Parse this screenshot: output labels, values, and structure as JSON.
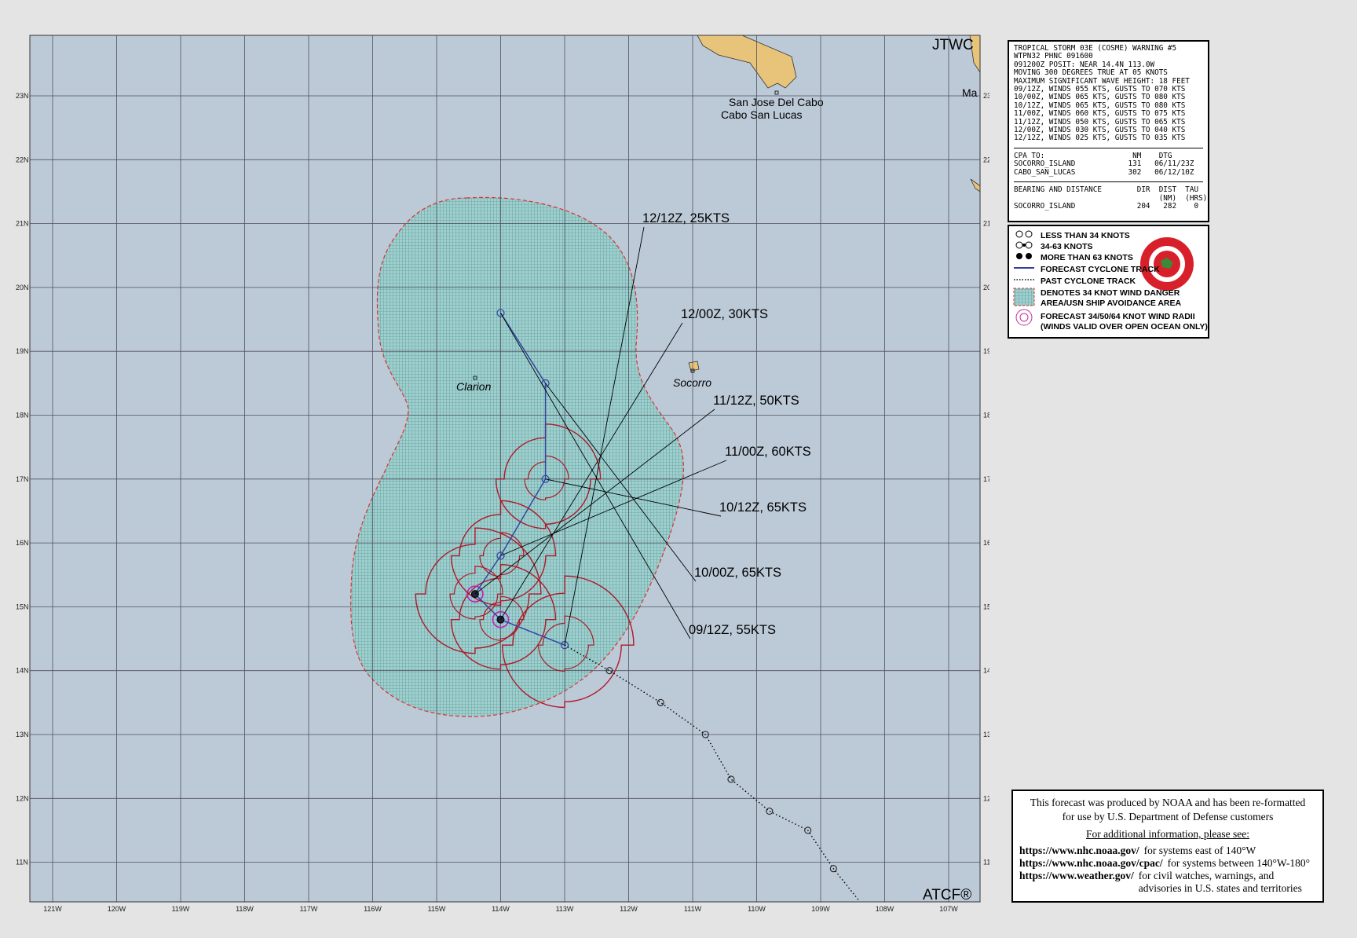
{
  "map": {
    "agency_label": "JTWC",
    "atcf_label": "ATCF®",
    "lon_labels": [
      "121W",
      "120W",
      "119W",
      "118W",
      "117W",
      "116W",
      "115W",
      "114W",
      "113W",
      "112W",
      "111W",
      "110W",
      "109W",
      "108W",
      "107W"
    ],
    "lat_labels": [
      "23N",
      "22N",
      "21N",
      "20N",
      "19N",
      "18N",
      "17N",
      "16N",
      "15N",
      "14N",
      "13N",
      "12N",
      "11N"
    ],
    "places": [
      {
        "name": "San Jose Del Cabo"
      },
      {
        "name": "Cabo San Lucas"
      },
      {
        "name": "Clarion"
      },
      {
        "name": "Socorro"
      },
      {
        "name": "Ma"
      }
    ],
    "forecast_labels": [
      "12/12Z,  25KTS",
      "12/00Z,  30KTS",
      "11/12Z,  50KTS",
      "11/00Z,  60KTS",
      "10/12Z,  65KTS",
      "10/00Z,  65KTS",
      "09/12Z,  55KTS"
    ],
    "forecast_track": [
      {
        "time": "09/12Z",
        "lat": 14.4,
        "lon": -113.0,
        "kts": 55
      },
      {
        "time": "10/00Z",
        "lat": 14.8,
        "lon": -114.0,
        "kts": 65
      },
      {
        "time": "10/12Z",
        "lat": 15.2,
        "lon": -114.4,
        "kts": 65
      },
      {
        "time": "11/00Z",
        "lat": 15.8,
        "lon": -114.0,
        "kts": 60
      },
      {
        "time": "11/12Z",
        "lat": 17.0,
        "lon": -113.3,
        "kts": 50
      },
      {
        "time": "12/00Z",
        "lat": 18.5,
        "lon": -113.3,
        "kts": 30
      },
      {
        "time": "12/12Z",
        "lat": 19.6,
        "lon": -114.0,
        "kts": 25
      }
    ],
    "past_track": [
      {
        "lat": 14.0,
        "lon": -112.3
      },
      {
        "lat": 13.5,
        "lon": -111.5
      },
      {
        "lat": 13.0,
        "lon": -110.8
      },
      {
        "lat": 12.3,
        "lon": -110.4
      },
      {
        "lat": 11.8,
        "lon": -109.8
      },
      {
        "lat": 11.5,
        "lon": -109.2
      },
      {
        "lat": 10.9,
        "lon": -108.8
      }
    ],
    "colors": {
      "ocean": "#bccad8",
      "land": "#e8c47a",
      "grid": "#4a4a5a",
      "danger_area": "#9fcfcf",
      "danger_border": "#e03030",
      "wind_radii": "#b01828",
      "track": "#3040a0",
      "small_radii": "#c020c0"
    }
  },
  "warning": {
    "header_lines": [
      "TROPICAL STORM 03E (COSME) WARNING #5",
      "WTPN32 PHNC 091600",
      "091200Z POSIT: NEAR 14.4N 113.0W",
      "MOVING 300 DEGREES TRUE AT 05 KNOTS",
      "MAXIMUM SIGNIFICANT WAVE HEIGHT: 18 FEET",
      "09/12Z, WINDS 055 KTS, GUSTS TO 070 KTS",
      "10/00Z, WINDS 065 KTS, GUSTS TO 080 KTS",
      "10/12Z, WINDS 065 KTS, GUSTS TO 080 KTS",
      "11/00Z, WINDS 060 KTS, GUSTS TO 075 KTS",
      "11/12Z, WINDS 050 KTS, GUSTS TO 065 KTS",
      "12/00Z, WINDS 030 KTS, GUSTS TO 040 KTS",
      "12/12Z, WINDS 025 KTS, GUSTS TO 035 KTS"
    ],
    "cpa_lines": [
      "CPA TO:                    NM    DTG",
      "SOCORRO_ISLAND            131   06/11/23Z",
      "CABO_SAN_LUCAS            302   06/12/10Z"
    ],
    "bearing_lines": [
      "BEARING AND DISTANCE        DIR  DIST  TAU",
      "                                 (NM)  (HRS)",
      "SOCORRO_ISLAND              204   282    0"
    ]
  },
  "legend": {
    "items": [
      "LESS THAN 34 KNOTS",
      "34-63 KNOTS",
      "MORE THAN 63 KNOTS",
      "FORECAST CYCLONE TRACK",
      "PAST CYCLONE TRACK",
      "DENOTES 34 KNOT WIND DANGER",
      "AREA/USN SHIP AVOIDANCE AREA",
      "FORECAST 34/50/64 KNOT WIND RADII",
      "(WINDS VALID OVER OPEN OCEAN ONLY)"
    ]
  },
  "noaa": {
    "line1": "This forecast was produced by NOAA and has been re-formatted",
    "line2": "for use by U.S. Department of Defense customers",
    "line3": "For additional information, please see:",
    "links": [
      {
        "url": "https://www.nhc.noaa.gov/",
        "desc": "for systems east of 140°W"
      },
      {
        "url": "https://www.nhc.noaa.gov/cpac/",
        "desc": "for systems between 140°W-180°"
      },
      {
        "url": "https://www.weather.gov/",
        "desc": "for civil watches, warnings, and advisories in U.S. states and territories"
      }
    ]
  }
}
